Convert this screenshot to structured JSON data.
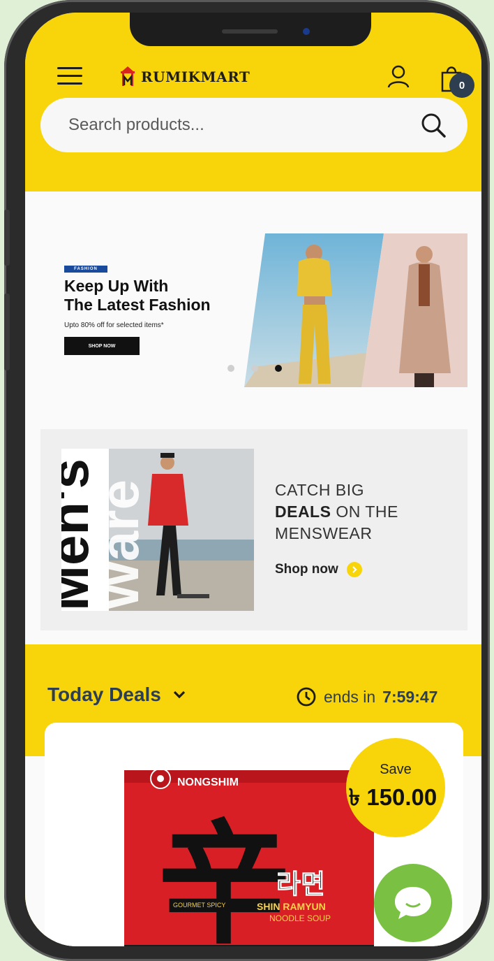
{
  "header": {
    "brand": "RUMIKMART",
    "cart_count": "0",
    "colors": {
      "brand_yellow": "#f8d50a",
      "dark_navy": "#2d3e50"
    }
  },
  "search": {
    "placeholder": "Search products..."
  },
  "hero_slide": {
    "tag": "FASHION",
    "title_line1": "Keep Up With",
    "title_line2": "The Latest Fashion",
    "subtitle": "Upto 80% off for selected items*",
    "button_label": "SHOP NOW",
    "slide_count": 3,
    "active_slide": 3
  },
  "promo": {
    "photo_text_1": "Men's",
    "photo_text_2": "Ware",
    "line1": "CATCH BIG",
    "line2_bold": "DEALS",
    "line2_rest": " ON THE",
    "line3": "MENSWEAR",
    "link_label": "Shop now"
  },
  "deals": {
    "title": "Today Deals",
    "ends_label": "ends in",
    "countdown": "7:59:47",
    "product": {
      "save_label": "Save",
      "save_amount": "৳ 150.00",
      "package_brand": "NONGSHIM",
      "package_name": "SHIN RAMYUN",
      "package_sub": "NOODLE SOUP",
      "package_korean": "라면",
      "package_char": "辛",
      "package_spicy": "GOURMET SPICY"
    }
  }
}
